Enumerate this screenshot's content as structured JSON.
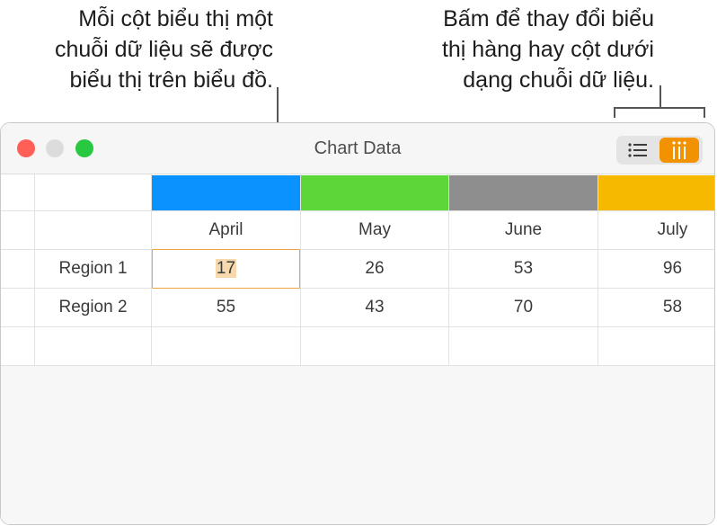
{
  "annotations": {
    "left_lines": [
      "Mỗi cột biểu thị một",
      "chuỗi dữ liệu sẽ được",
      "biểu thị trên biểu đồ."
    ],
    "right_lines": [
      "Bấm để thay đổi biểu",
      "thị hàng hay cột dưới",
      "dạng chuỗi dữ liệu."
    ]
  },
  "window": {
    "title": "Chart Data"
  },
  "toolbar": {
    "rows_icon": "list-icon",
    "columns_icon": "columns-icon",
    "selected": "columns"
  },
  "table": {
    "series_colors": [
      "#0a93ff",
      "#5cd737",
      "#8e8e8e",
      "#f7b800"
    ],
    "columns": [
      "April",
      "May",
      "June",
      "July"
    ],
    "rows": [
      {
        "label": "Region 1",
        "values": [
          "17",
          "26",
          "53",
          "96"
        ]
      },
      {
        "label": "Region 2",
        "values": [
          "55",
          "43",
          "70",
          "58"
        ]
      }
    ],
    "selected_cell": "17"
  }
}
